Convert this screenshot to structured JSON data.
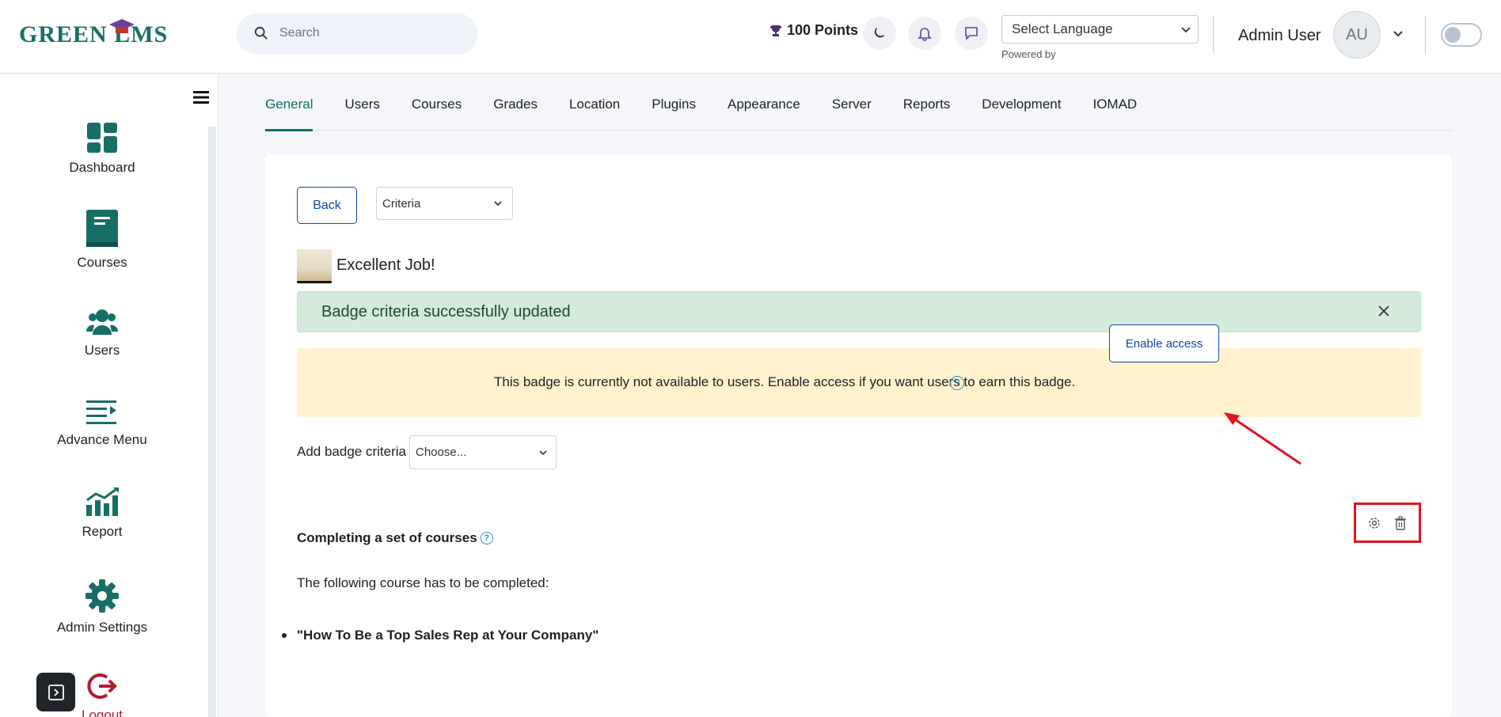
{
  "header": {
    "logo_text": "GREEN LMS",
    "search_placeholder": "Search",
    "points": "100 Points",
    "language": "Select Language",
    "powered_by": "Powered by",
    "user_name": "Admin User",
    "avatar_initials": "AU"
  },
  "sidebar": {
    "items": [
      {
        "label": "Dashboard",
        "icon": "dashboard-icon"
      },
      {
        "label": "Courses",
        "icon": "book-icon"
      },
      {
        "label": "Users",
        "icon": "users-icon"
      },
      {
        "label": "Advance Menu",
        "icon": "list-icon"
      },
      {
        "label": "Report",
        "icon": "chart-icon"
      },
      {
        "label": "Admin Settings",
        "icon": "gear-icon"
      },
      {
        "label": "Logout",
        "icon": "logout-icon"
      }
    ]
  },
  "tabs": [
    {
      "label": "General",
      "active": true
    },
    {
      "label": "Users"
    },
    {
      "label": "Courses"
    },
    {
      "label": "Grades"
    },
    {
      "label": "Location"
    },
    {
      "label": "Plugins"
    },
    {
      "label": "Appearance"
    },
    {
      "label": "Server"
    },
    {
      "label": "Reports"
    },
    {
      "label": "Development"
    },
    {
      "label": "IOMAD"
    }
  ],
  "main": {
    "back_label": "Back",
    "view_select": "Criteria",
    "badge_name": "Excellent Job!",
    "success_message": "Badge criteria successfully updated",
    "warning_message": "This badge is currently not available to users. Enable access if you want users to earn this badge.",
    "enable_label": "Enable access",
    "add_criteria_label": "Add badge criteria",
    "add_criteria_select": "Choose...",
    "criteria_title": "Completing a set of courses",
    "criteria_description": "The following course has to be completed:",
    "criteria_courses": [
      "\"How To Be a Top Sales Rep at Your Company\""
    ]
  },
  "colors": {
    "brand": "#0f6e69",
    "link_blue": "#0f47ad",
    "success_bg": "#d4ebdc",
    "warning_bg": "#fff2cc",
    "highlight": "#e0141e"
  }
}
